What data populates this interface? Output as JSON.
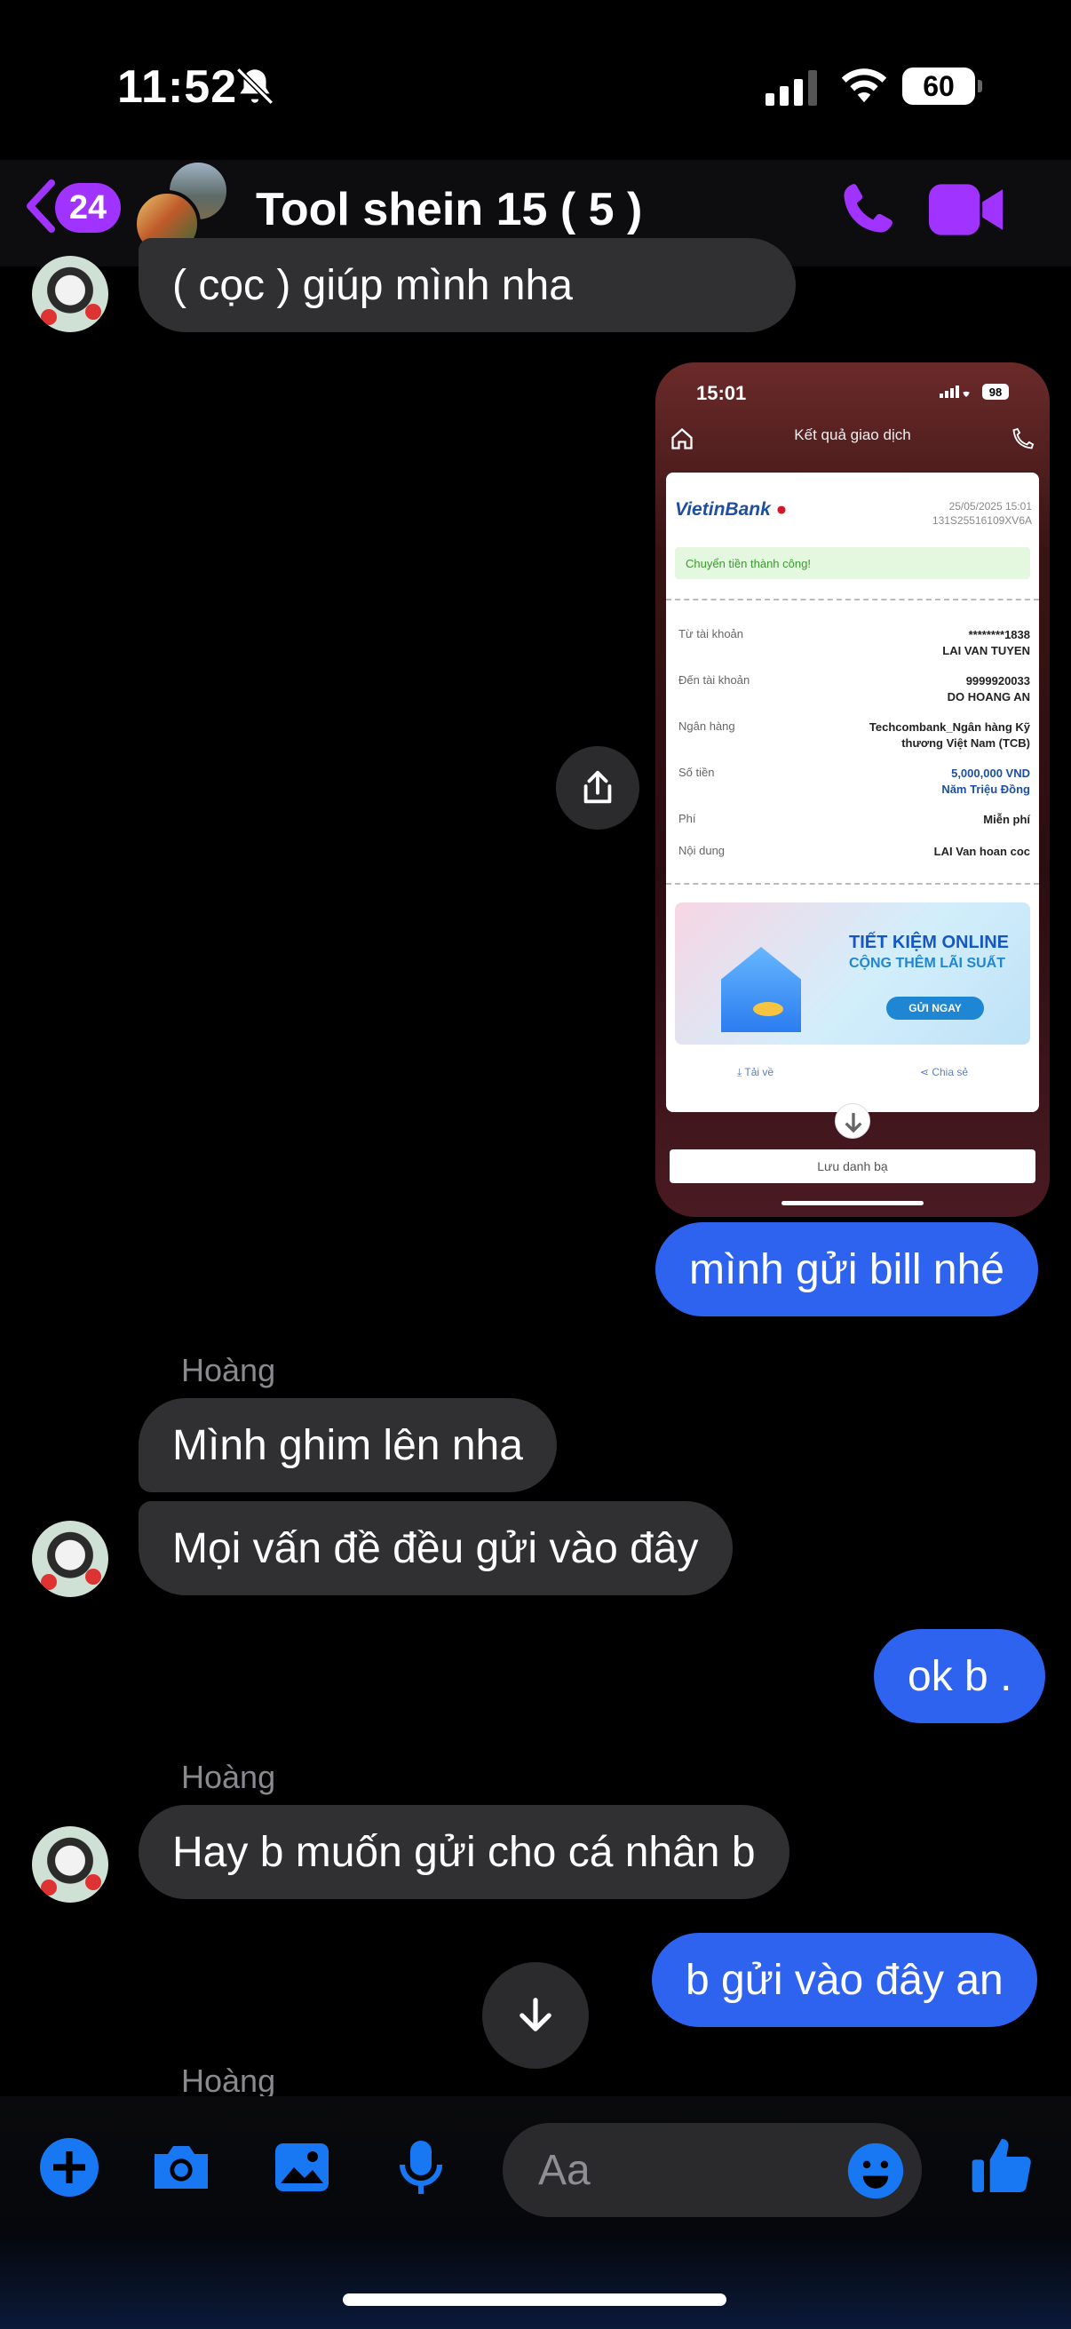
{
  "status_bar": {
    "time": "11:52",
    "battery": "60"
  },
  "header": {
    "back_count": "24",
    "title": "Tool shein 15 ( 5 )"
  },
  "messages": {
    "m1": "( cọc ) giúp mình nha",
    "m2": "mình gửi bill nhé",
    "sender1": "Hoàng",
    "m3": "Mình ghim lên nha",
    "m4": "Mọi vấn đề đều gửi vào đây",
    "m5": "ok b .",
    "sender2": "Hoàng",
    "m6": "Hay b muốn gửi cho cá nhân b",
    "m7": "b gửi vào đây an",
    "sender3": "Hoàng"
  },
  "receipt": {
    "time": "15:01",
    "battery": "98",
    "title": "Kết quả giao dịch",
    "bank_name_a": "Vietin",
    "bank_name_b": "Bank",
    "date": "25/05/2025 15:01",
    "ref": "131S25516109XV6A",
    "status": "Chuyển tiền thành công!",
    "rows": [
      {
        "label": "Từ tài khoản",
        "value": "********1838\nLAI VAN TUYEN"
      },
      {
        "label": "Đến tài khoản",
        "value": "9999920033\nDO HOANG AN"
      },
      {
        "label": "Ngân hàng",
        "value": "Techcombank_Ngân hàng Kỹ\nthương Việt Nam (TCB)"
      },
      {
        "label": "Số tiền",
        "value": "5,000,000 VND\nNăm Triệu Đồng"
      },
      {
        "label": "Phí",
        "value": "Miễn phí"
      },
      {
        "label": "Nội dung",
        "value": "LAI Van hoan coc"
      }
    ],
    "promo_title": "TIẾT KIỆM ONLINE",
    "promo_sub": "CỘNG THÊM LÃI SUẤT",
    "promo_btn": "GỬI NGAY",
    "download": "Tải về",
    "share": "Chia sẻ",
    "save_contact": "Lưu danh bạ"
  },
  "composer": {
    "placeholder": "Aa"
  },
  "colors": {
    "accent_purple": "#a033ff",
    "outgoing_blue": "#2e63f0",
    "icon_blue": "#1877f2",
    "incoming_bg": "#303033"
  },
  "icons": [
    "bell-slash-icon",
    "signal-icon",
    "wifi-icon",
    "back-chevron-icon",
    "phone-icon",
    "video-icon",
    "share-icon",
    "arrow-down-icon",
    "plus-icon",
    "camera-icon",
    "image-icon",
    "mic-icon",
    "emoji-icon",
    "thumbs-up-icon"
  ]
}
